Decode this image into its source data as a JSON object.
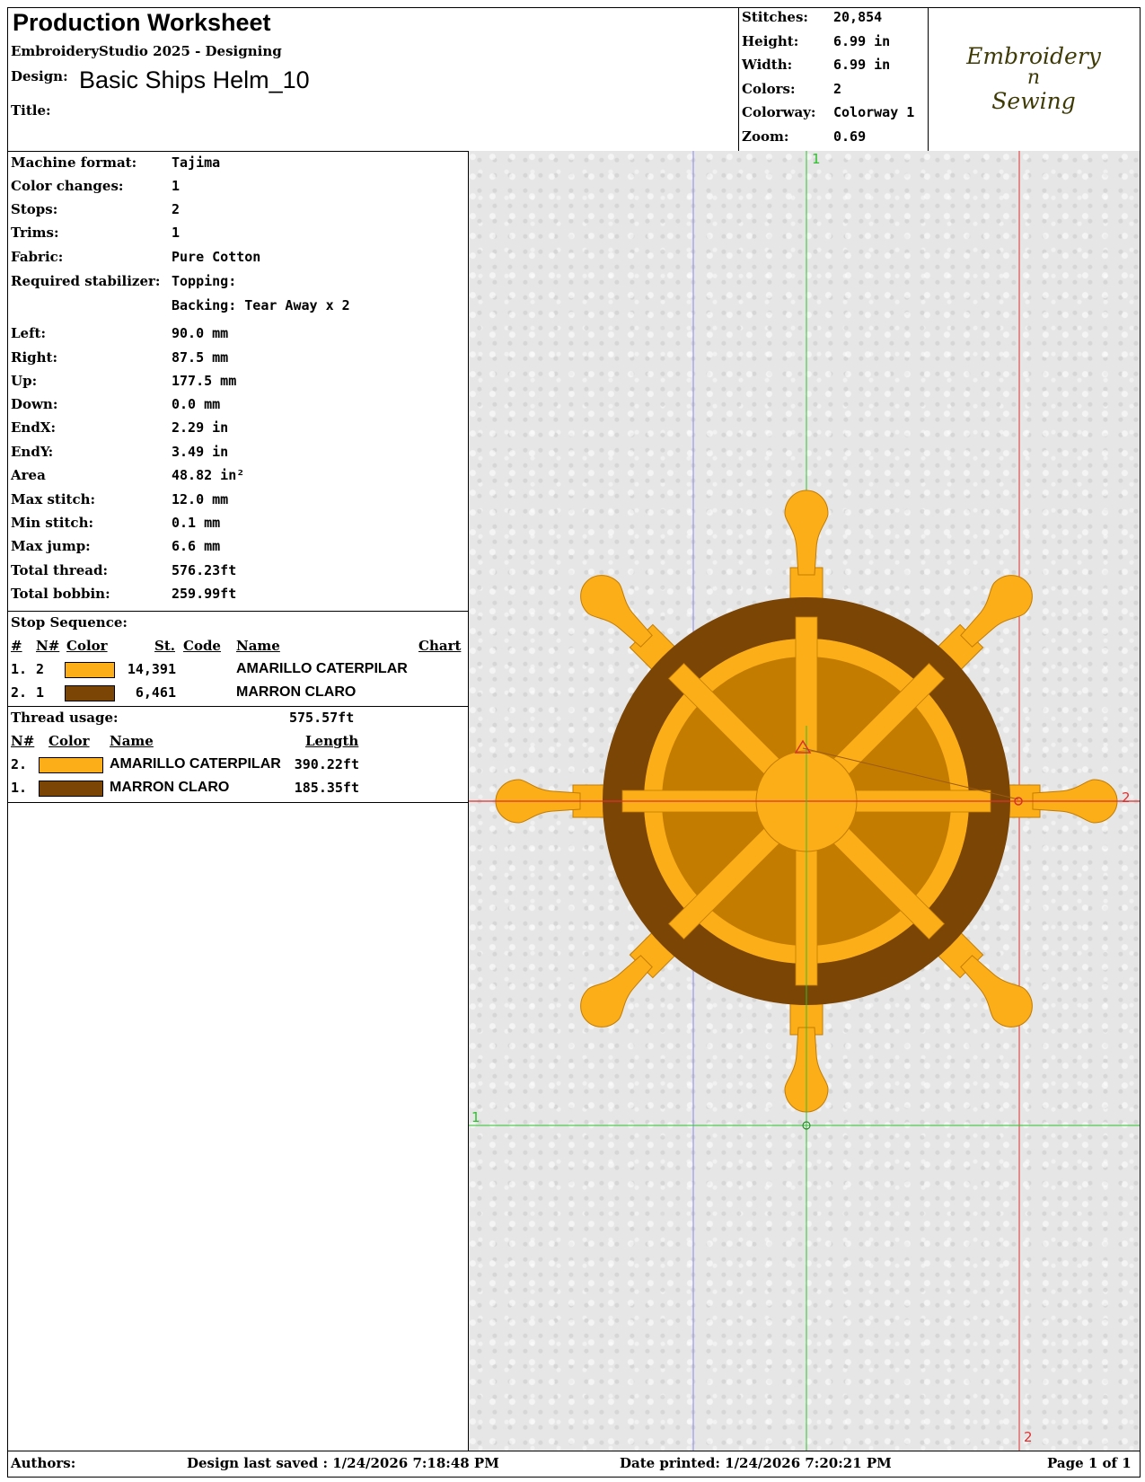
{
  "header": {
    "title": "Production Worksheet",
    "software": "EmbroideryStudio 2025 - Designing",
    "design_label": "Design:",
    "design_name": "Basic Ships Helm_10",
    "title_label": "Title:",
    "title_value": ""
  },
  "summary": [
    {
      "label": "Stitches:",
      "value": "20,854"
    },
    {
      "label": "Height:",
      "value": "6.99 in"
    },
    {
      "label": "Width:",
      "value": "6.99 in"
    },
    {
      "label": "Colors:",
      "value": "2"
    },
    {
      "label": "Colorway:",
      "value": "Colorway 1"
    },
    {
      "label": "Zoom:",
      "value": "0.69"
    }
  ],
  "logo": {
    "line1": "Embroidery",
    "line2": "n",
    "line3": "Sewing"
  },
  "details": [
    {
      "label": "Machine format:",
      "value": "Tajima"
    },
    {
      "label": "Color changes:",
      "value": "1"
    },
    {
      "label": "Stops:",
      "value": "2"
    },
    {
      "label": "Trims:",
      "value": "1"
    },
    {
      "label": "Fabric:",
      "value": "Pure Cotton"
    },
    {
      "label": "Required stabilizer:",
      "value": "Topping:"
    },
    {
      "label": "",
      "value": "Backing: Tear Away x 2"
    },
    {
      "label": "Left:",
      "value": "90.0 mm"
    },
    {
      "label": "Right:",
      "value": "87.5 mm"
    },
    {
      "label": "Up:",
      "value": "177.5 mm"
    },
    {
      "label": "Down:",
      "value": "0.0 mm"
    },
    {
      "label": "EndX:",
      "value": "2.29 in"
    },
    {
      "label": "EndY:",
      "value": "3.49 in"
    },
    {
      "label": "Area",
      "value": " 48.82 in²"
    },
    {
      "label": "Max stitch:",
      "value": "12.0 mm"
    },
    {
      "label": "Min stitch:",
      "value": "0.1 mm"
    },
    {
      "label": "Max jump:",
      "value": "6.6 mm"
    },
    {
      "label": "Total thread:",
      "value": "576.23ft"
    },
    {
      "label": "Total bobbin:",
      "value": "259.99ft"
    }
  ],
  "stop_sequence": {
    "title": "Stop Sequence:",
    "headers": {
      "num": "#",
      "n": "N#",
      "color": "Color",
      "st": "St.",
      "code": "Code",
      "name": "Name",
      "chart": "Chart"
    },
    "rows": [
      {
        "num": "1.",
        "n": "2",
        "color": "#FBAE17",
        "stitches": "14,391",
        "code": "",
        "name": "AMARILLO CATERPILAR"
      },
      {
        "num": "2.",
        "n": "1",
        "color": "#7B4506",
        "stitches": "6,461",
        "code": "",
        "name": "MARRON CLARO"
      }
    ]
  },
  "thread_usage": {
    "title": "Thread usage:",
    "total": "575.57ft",
    "headers": {
      "n": "N#",
      "color": "Color",
      "name": "Name",
      "length": "Length"
    },
    "rows": [
      {
        "n": "2.",
        "color": "#FBAE17",
        "name": "AMARILLO CATERPILAR",
        "length": "390.22ft"
      },
      {
        "n": "1.",
        "color": "#7B4506",
        "name": "MARRON CLARO",
        "length": "185.35ft"
      }
    ]
  },
  "canvas": {
    "marker_1": "1",
    "marker_2": "2",
    "colors": {
      "gold": "#FBAE17",
      "gold_edge": "#C47C00",
      "brown": "#7B4506",
      "brown_edge": "#4A2800"
    }
  },
  "footer": {
    "authors": "Authors:",
    "saved": "Design last saved : 1/24/2026 7:18:48 PM",
    "printed": "Date printed: 1/24/2026 7:20:21 PM",
    "page": "Page 1 of 1"
  }
}
